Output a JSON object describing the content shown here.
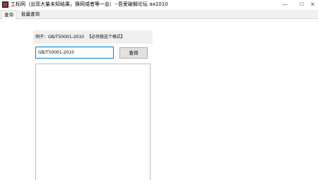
{
  "window": {
    "title": "工标网（出现大量未知结果，换网或者等一会）--吾爱破解论坛 aa1010",
    "minimize": "—",
    "maximize": "☐",
    "close": "✕"
  },
  "tabs": [
    {
      "label": "查询",
      "active": true
    },
    {
      "label": "批量查询",
      "active": false
    }
  ],
  "hint": {
    "example": "例子：GB/T50001-2010",
    "note": "【必须按这个格式】"
  },
  "search": {
    "value": "GB/T50001-2010",
    "button_label": "查询"
  },
  "result": {
    "text": ""
  }
}
